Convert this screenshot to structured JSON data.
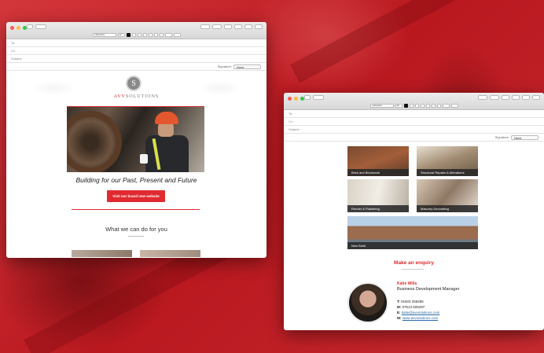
{
  "background": {
    "accent": "#c8262b"
  },
  "compose_window_1": {
    "format_bar": {
      "font": "Helvetica",
      "size": "12"
    },
    "fields": {
      "to": "To:",
      "cc": "Cc:",
      "subject": "Subject:"
    },
    "signature": {
      "label": "Signature:",
      "value": "None"
    },
    "email": {
      "brand": {
        "prefix": "AVV",
        "suffix": "SOLUTIONS",
        "monogram": "S"
      },
      "tagline": "Building for our Past, Present and Future",
      "cta_label": "Visit our brand new website",
      "section_title": "What we can do for you"
    }
  },
  "compose_window_2": {
    "format_bar": {
      "font": "Helvetica",
      "size": "12"
    },
    "fields": {
      "to": "To:",
      "cc": "Cc:",
      "subject": "Subject:"
    },
    "signature": {
      "label": "Signature:",
      "value": "None"
    },
    "services": [
      {
        "label": "Brick and Blockwork"
      },
      {
        "label": "Structural Repairs & Alterations"
      },
      {
        "label": "Render & Plastering"
      },
      {
        "label": "Masonry Decorating"
      },
      {
        "label": "New Build"
      }
    ],
    "enquiry": {
      "title": "Make an enquiry",
      "name": "Katie Wills",
      "role": "Business Development Manager",
      "t_label": "T:",
      "t": "01603 255285",
      "m_label": "M:",
      "m": "07513 505297",
      "e_label": "E:",
      "e": "katie@avvsolutions.com",
      "w_label": "W:",
      "w": "www.avvsolutions.com"
    }
  }
}
